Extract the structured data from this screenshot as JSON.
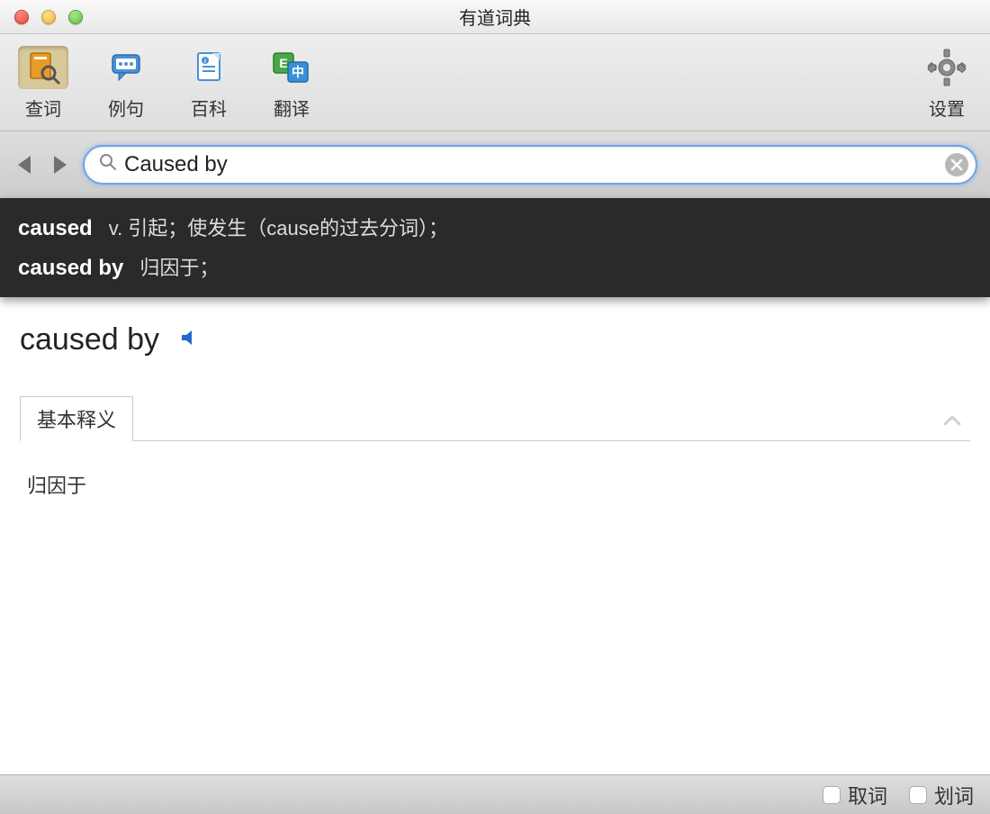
{
  "window": {
    "title": "有道词典"
  },
  "toolbar": {
    "lookup": "查词",
    "examples": "例句",
    "encyclopedia": "百科",
    "translate": "翻译",
    "settings": "设置"
  },
  "search": {
    "value": "Caused by",
    "placeholder": ""
  },
  "suggestions": [
    {
      "term": "caused",
      "definition": "v. 引起；使发生（cause的过去分词）；"
    },
    {
      "term": "caused by",
      "definition": "归因于；"
    }
  ],
  "entry": {
    "headword": "caused by",
    "tab_label": "基本释义",
    "definition": "归因于"
  },
  "bottom": {
    "word_pick": "取词",
    "stroke_pick": "划词"
  }
}
